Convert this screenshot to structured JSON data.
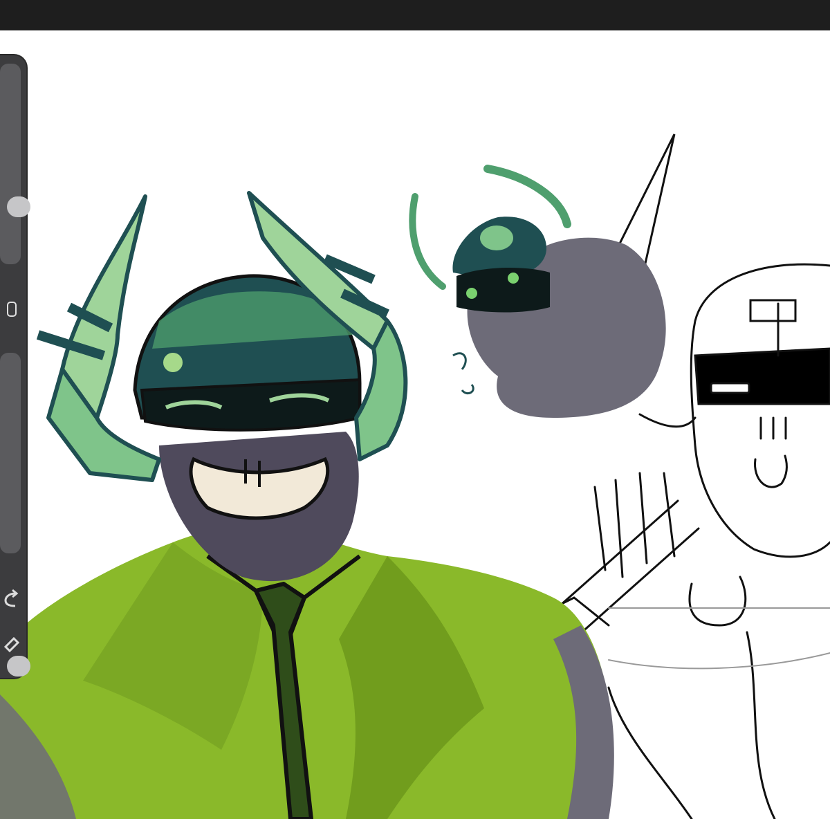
{
  "app": {
    "topbar_color": "#1e1e1e",
    "sidebar_color": "#3c3c3e"
  },
  "sidebar": {
    "brush_size_slider": {
      "icon": "slider-thumb",
      "level": 0.62
    },
    "modify_button": {
      "icon": "square-icon"
    },
    "brush_opacity_slider": {
      "icon": "slider-thumb",
      "level": 0.97
    },
    "undo_button": {
      "icon": "undo-icon"
    },
    "redo_button": {
      "icon": "redo-icon"
    }
  },
  "canvas": {
    "background": "#ffffff",
    "colors": {
      "shirt_green": "#8ab92a",
      "shirt_dark": "#6e9a1c",
      "helmet_teal": "#1f4f52",
      "horn_green": "#9fd49a",
      "skin_grey": "#4f4a5c",
      "blob_grey": "#6d6b78",
      "sketch_line": "#111111"
    }
  }
}
